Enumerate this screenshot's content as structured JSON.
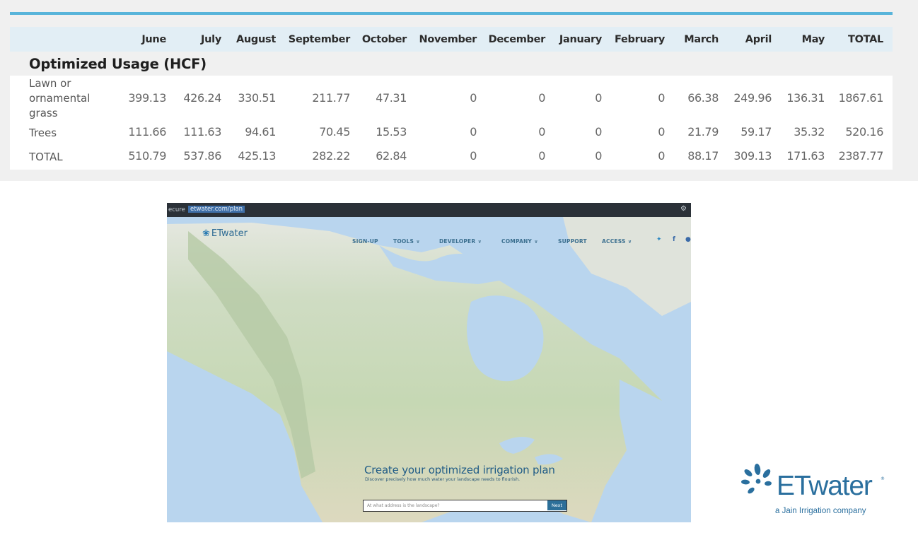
{
  "table": {
    "columns": [
      "June",
      "July",
      "August",
      "September",
      "October",
      "November",
      "December",
      "January",
      "February",
      "March",
      "April",
      "May",
      "TOTAL"
    ],
    "section_title": "Optimized Usage (HCF)",
    "rows": [
      {
        "label": "Lawn or\nornamental\ngrass",
        "values": [
          "399.13",
          "426.24",
          "330.51",
          "211.77",
          "47.31",
          "0",
          "0",
          "0",
          "0",
          "66.38",
          "249.96",
          "136.31",
          "1867.61"
        ]
      },
      {
        "label": "Trees",
        "values": [
          "111.66",
          "111.63",
          "94.61",
          "70.45",
          "15.53",
          "0",
          "0",
          "0",
          "0",
          "21.79",
          "59.17",
          "35.32",
          "520.16"
        ]
      },
      {
        "label": "TOTAL",
        "values": [
          "510.79",
          "537.86",
          "425.13",
          "282.22",
          "62.84",
          "0",
          "0",
          "0",
          "0",
          "88.17",
          "309.13",
          "171.63",
          "2387.77"
        ]
      }
    ]
  },
  "site": {
    "address_bar": {
      "secure": "ecure",
      "url": "etwater.com/plan"
    },
    "logo": "ETwater",
    "nav": [
      {
        "label": "SIGN-UP",
        "dropdown": false
      },
      {
        "label": "TOOLS",
        "dropdown": true
      },
      {
        "label": "DEVELOPER",
        "dropdown": true
      },
      {
        "label": "COMPANY",
        "dropdown": true
      },
      {
        "label": "SUPPORT",
        "dropdown": false
      },
      {
        "label": "ACCESS",
        "dropdown": true
      }
    ],
    "hero_title": "Create your optimized irrigation plan",
    "hero_subtitle": "Discover precisely how much water your landscape needs to flourish.",
    "search": {
      "placeholder": "At what address is the landscape?",
      "value": ""
    },
    "next_label": "Next",
    "icons": [
      "twitter-icon",
      "facebook-icon",
      "linkedin-icon",
      "settings-icon",
      "chevron-down-icon"
    ]
  },
  "brand": {
    "name": "ETwater",
    "tagline": "a Jain Irrigation company"
  },
  "colors": {
    "accent_rule": "#58b4da",
    "header_row": "#e2eef5",
    "panel_bg": "#f0f0f0",
    "brand_blue": "#2a6f9e",
    "next_button": "#2c6f99"
  }
}
